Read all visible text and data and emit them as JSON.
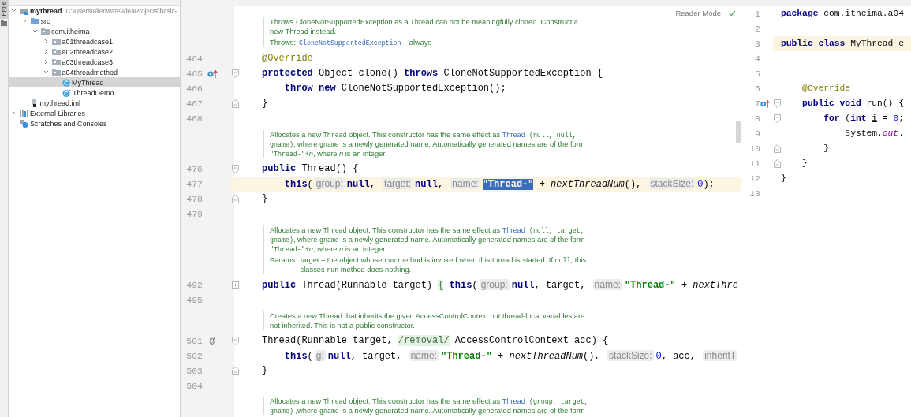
{
  "tool_strip": {
    "label": "Proje"
  },
  "project": {
    "tree": [
      {
        "label": "mythread",
        "kind": "module",
        "path": "C:\\Users\\alienware\\IdeaProjects\\basic-",
        "expanded": true,
        "selected": false,
        "children": [
          {
            "label": "src",
            "kind": "source-folder",
            "expanded": true,
            "selected": false,
            "children": [
              {
                "label": "com.itheima",
                "kind": "package",
                "expanded": true,
                "selected": false,
                "children": [
                  {
                    "label": "a01threadcase1",
                    "kind": "package",
                    "expanded": false,
                    "selected": false
                  },
                  {
                    "label": "a02threadcase2",
                    "kind": "package",
                    "expanded": false,
                    "selected": false
                  },
                  {
                    "label": "a03threadcase3",
                    "kind": "package",
                    "expanded": false,
                    "selected": false
                  },
                  {
                    "label": "a04threadmethod",
                    "kind": "package",
                    "expanded": true,
                    "selected": false,
                    "children": [
                      {
                        "label": "MyThread",
                        "kind": "class",
                        "selected": true
                      },
                      {
                        "label": "ThreadDemo",
                        "kind": "main-class",
                        "selected": false
                      }
                    ]
                  }
                ]
              }
            ]
          },
          {
            "label": "mythread.iml",
            "kind": "module-file",
            "selected": false
          }
        ]
      },
      {
        "label": "External Libraries",
        "kind": "libraries",
        "expanded": false,
        "selected": false
      },
      {
        "label": "Scratches and Consoles",
        "kind": "scratches",
        "selected": false
      }
    ]
  },
  "main_editor": {
    "reader_mode": "Reader Mode",
    "rows": [
      {
        "kind": "doc",
        "lines": [
          [
            {
              "kind": "text",
              "text": "Throws CloneNotSupportedException as a Thread can not be meaningfully cloned. Construct a"
            }
          ],
          [
            {
              "kind": "text",
              "text": "new Thread instead."
            }
          ]
        ],
        "tags": [
          {
            "label": "Throws:",
            "lines": [
              [
                {
                  "kind": "code-link",
                  "text": "CloneNotSupportedException"
                },
                {
                  "kind": "text",
                  "text": " – always"
                }
              ]
            ]
          }
        ]
      },
      {
        "kind": "code",
        "number": "464",
        "current": false,
        "tokens": [
          {
            "kind": "annotation",
            "text": "@Override"
          }
        ]
      },
      {
        "kind": "code",
        "number": "465",
        "current": false,
        "marker": {
          "kind": "override"
        },
        "fold": {
          "kind": "start"
        },
        "tokens": [
          {
            "kind": "keyword",
            "text": "protected"
          },
          {
            "kind": "plain",
            "text": " Object clone() "
          },
          {
            "kind": "keyword",
            "text": "throws"
          },
          {
            "kind": "plain",
            "text": " CloneNotSupportedException {"
          }
        ]
      },
      {
        "kind": "code",
        "number": "466",
        "current": false,
        "tokens": [
          {
            "kind": "keyword",
            "text": "    throw new"
          },
          {
            "kind": "plain",
            "text": " CloneNotSupportedException();"
          }
        ]
      },
      {
        "kind": "code",
        "number": "467",
        "current": false,
        "fold": {
          "kind": "end"
        },
        "tokens": [
          {
            "kind": "plain",
            "text": "}"
          }
        ]
      },
      {
        "kind": "code",
        "number": "468",
        "current": false,
        "tokens": []
      },
      {
        "kind": "doc",
        "lines": [
          [
            {
              "kind": "text",
              "text": "Allocates a new "
            },
            {
              "kind": "code",
              "text": "Thread"
            },
            {
              "kind": "text",
              "text": " object. This constructor has the same effect as "
            },
            {
              "kind": "link",
              "text": "Thread"
            },
            {
              "kind": "code",
              "text": " (null, null,"
            }
          ],
          [
            {
              "kind": "code",
              "text": "gname)"
            },
            {
              "kind": "text",
              "text": ", where "
            },
            {
              "kind": "code",
              "text": "gname"
            },
            {
              "kind": "text",
              "text": " is a newly generated name. Automatically generated names are of the form"
            }
          ],
          [
            {
              "kind": "code",
              "text": "\"Thread-\"+"
            },
            {
              "kind": "italic",
              "text": "n"
            },
            {
              "kind": "text",
              "text": ", where "
            },
            {
              "kind": "italic",
              "text": "n"
            },
            {
              "kind": "text",
              "text": " is an integer."
            }
          ]
        ]
      },
      {
        "kind": "code",
        "number": "476",
        "current": false,
        "fold": {
          "kind": "start"
        },
        "tokens": [
          {
            "kind": "keyword",
            "text": "public"
          },
          {
            "kind": "plain",
            "text": " Thread() {"
          }
        ]
      },
      {
        "kind": "code",
        "number": "477",
        "current": true,
        "tokens": [
          {
            "kind": "keyword",
            "text": "    this"
          },
          {
            "kind": "plain",
            "text": "("
          },
          {
            "kind": "hint",
            "text": "group:"
          },
          {
            "kind": "keyword",
            "text": "null"
          },
          {
            "kind": "plain",
            "text": ", "
          },
          {
            "kind": "hint",
            "text": "target:"
          },
          {
            "kind": "keyword",
            "text": "null"
          },
          {
            "kind": "plain",
            "text": ", "
          },
          {
            "kind": "hint",
            "text": "name:"
          },
          {
            "kind": "selection",
            "text": "\"Thread-\""
          },
          {
            "kind": "plain",
            "text": " + "
          },
          {
            "kind": "method",
            "text": "nextThreadNum"
          },
          {
            "kind": "plain",
            "text": "(), "
          },
          {
            "kind": "hint",
            "text": "stackSize:"
          },
          {
            "kind": "number",
            "text": "0"
          },
          {
            "kind": "plain",
            "text": ");"
          }
        ]
      },
      {
        "kind": "code",
        "number": "478",
        "current": false,
        "fold": {
          "kind": "end"
        },
        "tokens": [
          {
            "kind": "plain",
            "text": "}"
          }
        ]
      },
      {
        "kind": "code",
        "number": "479",
        "current": false,
        "tokens": []
      },
      {
        "kind": "doc",
        "lines": [
          [
            {
              "kind": "text",
              "text": "Allocates a new "
            },
            {
              "kind": "code",
              "text": "Thread"
            },
            {
              "kind": "text",
              "text": " object. This constructor has the same effect as "
            },
            {
              "kind": "link",
              "text": "Thread"
            },
            {
              "kind": "code",
              "text": " (null, target,"
            }
          ],
          [
            {
              "kind": "code",
              "text": "gname)"
            },
            {
              "kind": "text",
              "text": ", where "
            },
            {
              "kind": "code",
              "text": "gname"
            },
            {
              "kind": "text",
              "text": " is a newly generated name. Automatically generated names are of the form"
            }
          ],
          [
            {
              "kind": "code",
              "text": "\"Thread-\"+"
            },
            {
              "kind": "italic",
              "text": "n"
            },
            {
              "kind": "text",
              "text": ", where "
            },
            {
              "kind": "italic",
              "text": "n"
            },
            {
              "kind": "text",
              "text": " is an integer."
            }
          ]
        ],
        "tags": [
          {
            "label": "Params:",
            "lines": [
              [
                {
                  "kind": "text",
                  "text": "target – the object whose "
                },
                {
                  "kind": "code",
                  "text": "run"
                },
                {
                  "kind": "text",
                  "text": " method is invoked when this thread is started. If "
                },
                {
                  "kind": "code",
                  "text": "null"
                },
                {
                  "kind": "text",
                  "text": ", this"
                }
              ],
              [
                {
                  "kind": "text",
                  "text": "classes "
                },
                {
                  "kind": "code",
                  "text": "run"
                },
                {
                  "kind": "text",
                  "text": " method does nothing."
                }
              ]
            ]
          }
        ]
      },
      {
        "kind": "code",
        "number": "492",
        "current": false,
        "fold": {
          "kind": "collapsed"
        },
        "tokens": [
          {
            "kind": "keyword",
            "text": "public"
          },
          {
            "kind": "plain",
            "text": " Thread(Runnable target) "
          },
          {
            "kind": "folded",
            "text": "{"
          },
          {
            "kind": "keyword",
            "text": " this"
          },
          {
            "kind": "plain",
            "text": "("
          },
          {
            "kind": "hint",
            "text": "group:"
          },
          {
            "kind": "keyword",
            "text": "null"
          },
          {
            "kind": "plain",
            "text": ", target, "
          },
          {
            "kind": "hint",
            "text": "name:"
          },
          {
            "kind": "string",
            "text": "\"Thread-\""
          },
          {
            "kind": "plain",
            "text": " + "
          },
          {
            "kind": "method",
            "text": "nextThre"
          }
        ]
      },
      {
        "kind": "code",
        "number": "495",
        "current": false,
        "tokens": []
      },
      {
        "kind": "doc",
        "lines": [
          [
            {
              "kind": "text",
              "text": "Creates a new Thread that inherits the given AccessControlContext but thread-local variables are"
            }
          ],
          [
            {
              "kind": "text",
              "text": "not inherited. This is not a public constructor."
            }
          ]
        ]
      },
      {
        "kind": "code",
        "number": "501",
        "current": false,
        "marker": {
          "kind": "text",
          "text": "@"
        },
        "fold": {
          "kind": "start"
        },
        "tokens": [
          {
            "kind": "plain",
            "text": "Thread(Runnable target, "
          },
          {
            "kind": "folded",
            "text": "/removal/"
          },
          {
            "kind": "plain",
            "text": " AccessControlContext acc) {"
          }
        ]
      },
      {
        "kind": "code",
        "number": "502",
        "current": false,
        "tokens": [
          {
            "kind": "keyword",
            "text": "    this"
          },
          {
            "kind": "plain",
            "text": "("
          },
          {
            "kind": "hint",
            "text": "g:"
          },
          {
            "kind": "keyword",
            "text": "null"
          },
          {
            "kind": "plain",
            "text": ", target, "
          },
          {
            "kind": "hint",
            "text": "name:"
          },
          {
            "kind": "string",
            "text": "\"Thread-\""
          },
          {
            "kind": "plain",
            "text": " + "
          },
          {
            "kind": "method",
            "text": "nextThreadNum"
          },
          {
            "kind": "plain",
            "text": "(), "
          },
          {
            "kind": "hint",
            "text": "stackSize:"
          },
          {
            "kind": "number",
            "text": "0"
          },
          {
            "kind": "plain",
            "text": ", acc, "
          },
          {
            "kind": "hint",
            "text": "inheritT"
          }
        ]
      },
      {
        "kind": "code",
        "number": "503",
        "current": false,
        "fold": {
          "kind": "end"
        },
        "tokens": [
          {
            "kind": "plain",
            "text": "}"
          }
        ]
      },
      {
        "kind": "code",
        "number": "504",
        "current": false,
        "tokens": []
      },
      {
        "kind": "doc",
        "lines": [
          [
            {
              "kind": "text",
              "text": "Allocates a new "
            },
            {
              "kind": "code",
              "text": "Thread"
            },
            {
              "kind": "text",
              "text": " object. This constructor has the same effect as "
            },
            {
              "kind": "link",
              "text": "Thread"
            },
            {
              "kind": "code",
              "text": " (group, target,"
            }
          ],
          [
            {
              "kind": "code",
              "text": "gname)"
            },
            {
              "kind": "text",
              "text": " ,where "
            },
            {
              "kind": "code",
              "text": "gname"
            },
            {
              "kind": "text",
              "text": " is a newly generated name. Automatically generated names are of the form"
            }
          ]
        ]
      }
    ]
  },
  "side_editor": {
    "rows": [
      {
        "kind": "code",
        "number": "1",
        "current": false,
        "tokens": [
          {
            "kind": "keyword",
            "text": "package"
          },
          {
            "kind": "plain",
            "text": " com.itheima.a04"
          }
        ]
      },
      {
        "kind": "code",
        "number": "2",
        "current": false,
        "tokens": []
      },
      {
        "kind": "code",
        "number": "3",
        "current": true,
        "tokens": [
          {
            "kind": "keyword",
            "text": "public class"
          },
          {
            "kind": "plain",
            "text": " MyThread e"
          }
        ]
      },
      {
        "kind": "code",
        "number": "4",
        "current": false,
        "tokens": []
      },
      {
        "kind": "code",
        "number": "5",
        "current": false,
        "tokens": []
      },
      {
        "kind": "code",
        "number": "6",
        "current": false,
        "tokens": [
          {
            "kind": "annotation",
            "text": "    @Override"
          }
        ]
      },
      {
        "kind": "code",
        "number": "7",
        "current": false,
        "marker": {
          "kind": "override"
        },
        "fold": {
          "kind": "start"
        },
        "tokens": [
          {
            "kind": "keyword",
            "text": "    public void"
          },
          {
            "kind": "plain",
            "text": " run() {"
          }
        ]
      },
      {
        "kind": "code",
        "number": "8",
        "current": false,
        "fold": {
          "kind": "start"
        },
        "tokens": [
          {
            "kind": "keyword",
            "text": "        for"
          },
          {
            "kind": "plain",
            "text": " ("
          },
          {
            "kind": "keyword",
            "text": "int "
          },
          {
            "kind": "underlined",
            "text": "i"
          },
          {
            "kind": "plain",
            "text": " = "
          },
          {
            "kind": "number",
            "text": "0"
          },
          {
            "kind": "plain",
            "text": ";"
          }
        ]
      },
      {
        "kind": "code",
        "number": "9",
        "current": false,
        "tokens": [
          {
            "kind": "plain",
            "text": "            System."
          },
          {
            "kind": "field",
            "text": "out"
          },
          {
            "kind": "plain",
            "text": "."
          }
        ]
      },
      {
        "kind": "code",
        "number": "10",
        "current": false,
        "fold": {
          "kind": "end"
        },
        "tokens": [
          {
            "kind": "plain",
            "text": "        }"
          }
        ]
      },
      {
        "kind": "code",
        "number": "11",
        "current": false,
        "fold": {
          "kind": "end"
        },
        "tokens": [
          {
            "kind": "plain",
            "text": "    }"
          }
        ]
      },
      {
        "kind": "code",
        "number": "12",
        "current": false,
        "tokens": [
          {
            "kind": "plain",
            "text": "}"
          }
        ]
      },
      {
        "kind": "code",
        "number": "13",
        "current": false,
        "tokens": []
      }
    ]
  }
}
